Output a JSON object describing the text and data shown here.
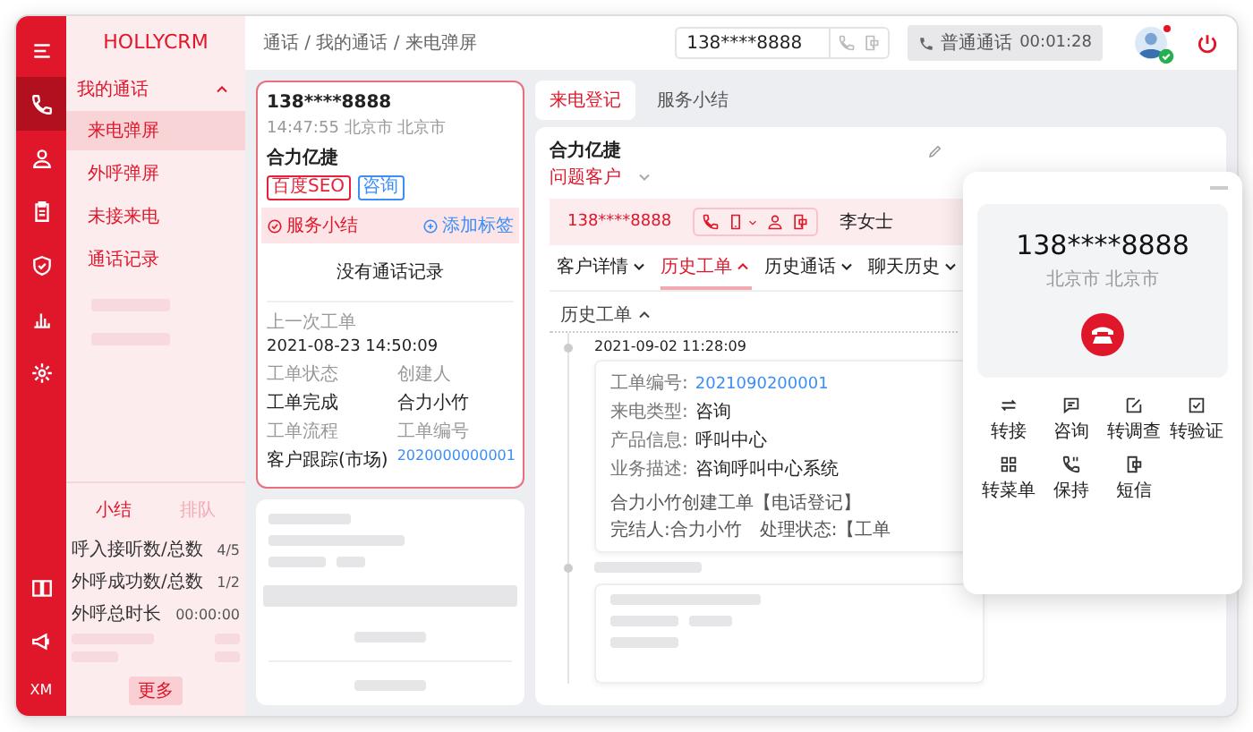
{
  "rail": {
    "top": [
      {
        "kind": "menu",
        "selected": false
      },
      {
        "kind": "phone",
        "selected": true
      },
      {
        "kind": "person",
        "selected": false
      },
      {
        "kind": "clipboard",
        "selected": false
      },
      {
        "kind": "shield",
        "selected": false
      },
      {
        "kind": "bar-chart",
        "selected": false
      },
      {
        "kind": "gear",
        "selected": false
      }
    ],
    "bottom": [
      {
        "kind": "book",
        "selected": false
      },
      {
        "kind": "megaphone",
        "selected": false
      }
    ],
    "user_initials": "XM"
  },
  "sidebar": {
    "logo": "HOLLYCRM",
    "group": {
      "label": "我的通话",
      "expanded": true,
      "items": [
        {
          "label": "来电弹屏",
          "selected": true
        },
        {
          "label": "外呼弹屏",
          "selected": false
        },
        {
          "label": "未接来电",
          "selected": false
        },
        {
          "label": "通话记录",
          "selected": false
        }
      ]
    },
    "summary": {
      "tabs": [
        {
          "label": "小结",
          "selected": true
        },
        {
          "label": "排队",
          "selected": false
        }
      ],
      "stats": [
        {
          "label": "呼入接听数/总数",
          "value": "4/5"
        },
        {
          "label": "外呼成功数/总数",
          "value": "1/2"
        },
        {
          "label": "外呼总时长",
          "value": "00:00:00"
        }
      ],
      "more": "更多"
    }
  },
  "topbar": {
    "breadcrumb": "通话 / 我的通话 / 来电弹屏",
    "dial": {
      "value": "138****8888"
    },
    "call_status": {
      "type": "普通通话",
      "duration": "00:01:28"
    },
    "agent": {
      "online": true,
      "unread": true
    }
  },
  "call_card": {
    "phone": "138****8888",
    "time_location": "14:47:55 北京市 北京市",
    "company": "合力亿捷",
    "tags": [
      {
        "label": "百度SEO",
        "color": "#e8203a"
      },
      {
        "label": "咨询",
        "color": "#3a8ef6"
      }
    ],
    "summary_link": "服务小结",
    "add_tag": "添加标签",
    "no_records": "没有通话记录",
    "last_order_title": "上一次工单",
    "last_order_time": "2021-08-23 14:50:09",
    "fields": [
      {
        "label": "工单状态",
        "value": "工单完成",
        "kind": "text"
      },
      {
        "label": "创建人",
        "value": "合力小竹",
        "kind": "text"
      },
      {
        "label": "工单流程",
        "value": "客户跟踪(市场)",
        "kind": "text"
      },
      {
        "label": "工单编号",
        "value": "2020000000001",
        "kind": "link"
      }
    ]
  },
  "main": {
    "tabs": [
      {
        "label": "来电登记",
        "selected": true
      },
      {
        "label": "服务小结",
        "selected": false
      }
    ],
    "customer": {
      "name": "合力亿捷",
      "level": "问题客户",
      "phone": "138****8888",
      "contact": "李女士"
    },
    "subtabs": [
      {
        "label": "客户详情",
        "selected": false
      },
      {
        "label": "历史工单",
        "selected": true
      },
      {
        "label": "历史通话",
        "selected": false
      },
      {
        "label": "聊天历史",
        "selected": false
      }
    ],
    "history": {
      "title": "历史工单",
      "expanded": true,
      "entries": [
        {
          "time": "2021-09-02 11:28:09",
          "fields": [
            {
              "label": "工单编号:",
              "value": "2021090200001",
              "kind": "link"
            },
            {
              "label": "来电类型:",
              "value": "咨询",
              "kind": "text"
            },
            {
              "label": "产品信息:",
              "value": "呼叫中心",
              "kind": "text"
            },
            {
              "label": "业务描述:",
              "value": "咨询呼叫中心系统",
              "kind": "text"
            }
          ],
          "footer": [
            "合力小竹创建工单【电话登记】",
            "完结人:合力小竹",
            "处理状态:【工单"
          ]
        }
      ]
    }
  },
  "call_popup": {
    "phone": "138****8888",
    "location": "北京市 北京市",
    "actions": [
      {
        "label": "转接",
        "kind": "transfer"
      },
      {
        "label": "咨询",
        "kind": "chat"
      },
      {
        "label": "转调查",
        "kind": "edit"
      },
      {
        "label": "转验证",
        "kind": "checkdoc"
      },
      {
        "label": "转菜单",
        "kind": "grid"
      },
      {
        "label": "保持",
        "kind": "hold"
      },
      {
        "label": "短信",
        "kind": "sms"
      }
    ]
  }
}
